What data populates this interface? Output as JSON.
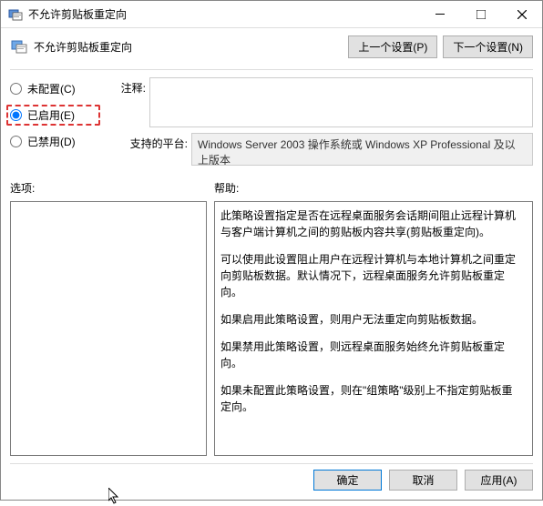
{
  "titlebar": {
    "text": "不允许剪贴板重定向"
  },
  "header": {
    "title": "不允许剪贴板重定向"
  },
  "nav": {
    "prev": "上一个设置(P)",
    "next": "下一个设置(N)"
  },
  "radios": {
    "not_configured": "未配置(C)",
    "enabled": "已启用(E)",
    "disabled": "已禁用(D)"
  },
  "fields": {
    "comment_label": "注释:",
    "comment_value": "",
    "platform_label": "支持的平台:",
    "platform_value": "Windows Server 2003 操作系统或 Windows XP Professional 及以上版本"
  },
  "sections": {
    "options": "选项:",
    "help": "帮助:"
  },
  "help": {
    "p1": "此策略设置指定是否在远程桌面服务会话期间阻止远程计算机与客户端计算机之间的剪贴板内容共享(剪贴板重定向)。",
    "p2": "可以使用此设置阻止用户在远程计算机与本地计算机之间重定向剪贴板数据。默认情况下，远程桌面服务允许剪贴板重定向。",
    "p3": "如果启用此策略设置，则用户无法重定向剪贴板数据。",
    "p4": "如果禁用此策略设置，则远程桌面服务始终允许剪贴板重定向。",
    "p5": "如果未配置此策略设置，则在\"组策略\"级别上不指定剪贴板重定向。"
  },
  "footer": {
    "ok": "确定",
    "cancel": "取消",
    "apply": "应用(A)"
  }
}
